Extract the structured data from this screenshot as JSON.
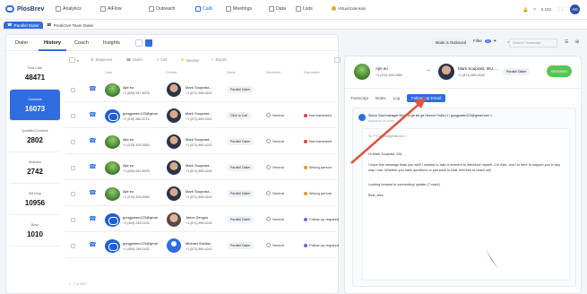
{
  "app": {
    "logo": "PlosBrev",
    "ext_label": "Virtual Extension",
    "user_initials": "AD",
    "credit": "0.183"
  },
  "nav": [
    {
      "label": "Analytics"
    },
    {
      "label": "AiFlow"
    },
    {
      "label": "Outreach"
    },
    {
      "label": "Calls"
    },
    {
      "label": "Meetings"
    },
    {
      "label": "Data"
    },
    {
      "label": "Lists"
    }
  ],
  "dialer_tabs": [
    {
      "label": "Parallel Dialer"
    },
    {
      "label": "Predictive Team Dialer"
    }
  ],
  "subtabs": [
    {
      "label": "Dialer"
    },
    {
      "label": "History"
    },
    {
      "label": "Coach"
    },
    {
      "label": "Insights"
    }
  ],
  "stats": [
    {
      "label": "Total Calls",
      "value": "48471"
    },
    {
      "label": "Connects",
      "value": "16073"
    },
    {
      "label": "Qualified Contacts",
      "value": "2802"
    },
    {
      "label": "Abandon",
      "value": "2742"
    },
    {
      "label": "VM Drop",
      "value": "10956"
    },
    {
      "label": "Busy",
      "value": "1010"
    }
  ],
  "toolbar": {
    "sequence": "Sequence",
    "dialer": "Dialer",
    "list": "List",
    "booster": "Booster",
    "export": "Export"
  },
  "table_headers": {
    "lead": "Lead",
    "contact": "Contact",
    "name": "Name",
    "sentiment": "Sentiment",
    "disposition": "Disposition"
  },
  "rows": [
    {
      "lead": "Ajie eu",
      "lead_num": "+1 (626) 647-6076",
      "tag": "",
      "member": "Mark Souprast...",
      "member_num": "+1 (571) 890-4242",
      "pill": "Parallel Dialer",
      "sentiment": "",
      "disposition": "",
      "thumb": "green",
      "face": "a"
    },
    {
      "lead": "gongjuwen123@gmai",
      "lead_num": "+1 (615) 860-5715",
      "tag": "",
      "member": "Mark Souprast...",
      "member_num": "+1 (571) 890-4242",
      "pill": "Click to Call",
      "sentiment": "Neutral",
      "disposition": "Not interested",
      "thumb": "blue",
      "face": "a",
      "dcolor": "r"
    },
    {
      "lead": "Ajie eu",
      "lead_num": "+1 (213) 493-0083",
      "tag": "",
      "member": "Mark Souprast...",
      "member_num": "+1 (571) 890-4242",
      "pill": "Parallel Dialer",
      "sentiment": "Neutral",
      "disposition": "Not interested",
      "thumb": "green",
      "face": "a",
      "dcolor": "r"
    },
    {
      "lead": "Ajie eu",
      "lead_num": "+1 (626) 647-6076",
      "tag": "",
      "member": "Mark Souprast...",
      "member_num": "+1 (571) 890-4242",
      "pill": "Parallel Dialer",
      "sentiment": "Neutral",
      "disposition": "Wrong person",
      "thumb": "green",
      "face": "a",
      "dcolor": "g"
    },
    {
      "lead": "Ajie eu",
      "lead_num": "+1 (213) 493-0083",
      "tag": "",
      "member": "Mark Souprast...",
      "member_num": "+1 (571) 890-4242",
      "pill": "Parallel Dialer",
      "sentiment": "Neutral",
      "disposition": "Wrong person",
      "thumb": "green",
      "face": "a",
      "dcolor": "g"
    },
    {
      "lead": "gongjuwen123@gmai",
      "lead_num": "+1 (404) 249-1432",
      "tag": "",
      "member": "Jason Zengus",
      "member_num": "+1 (571) 890-4242",
      "pill": "Parallel Dialer",
      "sentiment": "Neutral",
      "disposition": "Follow-up required",
      "thumb": "blue",
      "face": "z",
      "dcolor": "b"
    },
    {
      "lead": "gongjuwen123@gmai",
      "lead_num": "+1 (404) 249-1432",
      "tag": "",
      "member": "Michael Shelton",
      "member_num": "+1 (571) 890-4242",
      "pill": "Parallel Dialer",
      "sentiment": "Neutral",
      "disposition": "Follow-up required",
      "thumb": "blue",
      "face": "icon",
      "dcolor": "b"
    }
  ],
  "right": {
    "mode_label": "Mode is Outbound",
    "filter_label": "Filter",
    "filter_count": "11",
    "search_placeholder": "Search Transcript",
    "caller_name": "Ajie eu",
    "caller_num": "+1 (213) 493-0083",
    "callee_name": "Mark Souprast, MU, ...",
    "callee_num": "+1 (571) 890-4242",
    "mode_pill": "Parallel Dialer",
    "status_btn": "SENDING",
    "tabs": [
      {
        "label": "Transcript"
      },
      {
        "label": "Notes"
      },
      {
        "label": "Log"
      },
      {
        "label": "Follow-Up Email"
      }
    ],
    "email_subject": "Simon Saul manager MUI Hu ge shi ge Hennin YinDa Li | gongjuwen123@gmail.com >",
    "email_date": "2024-09-01 03:13 PM",
    "email_to": "To: ** ▾ simon@gmail.com >",
    "email_greeting": "Hi Mark Souprast, MU,",
    "email_body": "I hope this message finds you well! I wanted to take a moment to introduce myself—I'm Alex, and I'm here to support you in any way I can. Whether you have questions or just want to chat, feel free to reach out!",
    "email_close": "Looking forward to connecting! update (T-mark)",
    "email_sign": "Best, Alex"
  },
  "footer": "1 - 7 of 5057",
  "colors": {
    "accent": "#2f6de1",
    "green": "#5cc453",
    "arrow": "#e0533d"
  }
}
